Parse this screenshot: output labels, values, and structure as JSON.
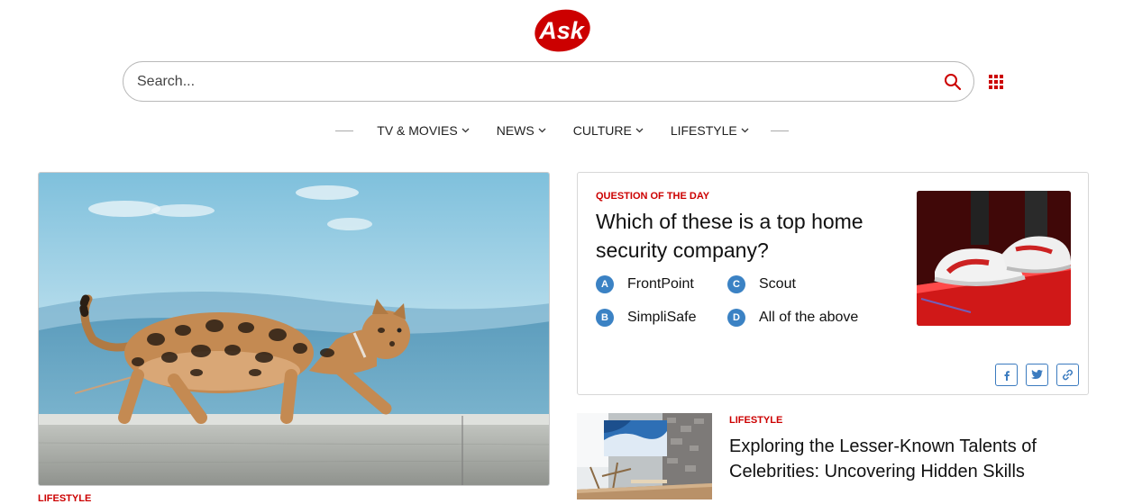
{
  "logo": {
    "text": "Ask"
  },
  "search": {
    "placeholder": "Search...",
    "value": ""
  },
  "nav": {
    "items": [
      "TV & MOVIES",
      "NEWS",
      "CULTURE",
      "LIFESTYLE"
    ]
  },
  "hero": {
    "category": "LIFESTYLE"
  },
  "question": {
    "tag": "QUESTION OF THE DAY",
    "text": "Which of these is a top home security company?",
    "options": [
      {
        "letter": "A",
        "label": "FrontPoint"
      },
      {
        "letter": "B",
        "label": "SimpliSafe"
      },
      {
        "letter": "C",
        "label": "Scout"
      },
      {
        "letter": "D",
        "label": "All of the above"
      }
    ]
  },
  "article": {
    "category": "LIFESTYLE",
    "title": "Exploring the Lesser-Known Talents of Celebrities: Uncovering Hidden Skills"
  },
  "colors": {
    "brand": "#cc0000",
    "option": "#3b82c4",
    "share": "#3b7bbf"
  },
  "icons": [
    "search-icon",
    "apps-grid-icon",
    "chevron-down-icon",
    "facebook-icon",
    "twitter-icon",
    "link-icon"
  ]
}
